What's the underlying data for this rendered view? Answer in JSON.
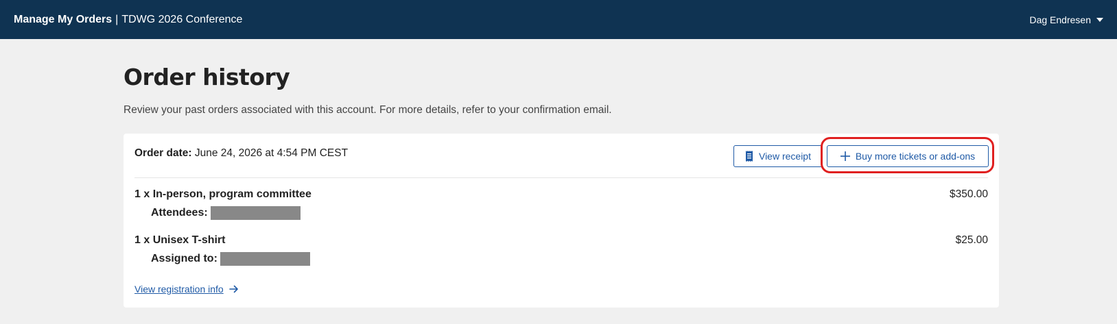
{
  "header": {
    "app_title": "Manage My Orders",
    "separator": "|",
    "event_name": "TDWG 2026 Conference",
    "user_name": "Dag Endresen"
  },
  "page": {
    "title": "Order history",
    "subtitle": "Review your past orders associated with this account. For more details, refer to your confirmation email."
  },
  "order": {
    "date_label": "Order date:",
    "date_value": "June 24, 2026 at 4:54 PM CEST",
    "view_receipt_label": "View receipt",
    "buy_more_label": "Buy more tickets or add-ons",
    "items": [
      {
        "name": "1 x In-person, program committee",
        "price": "$350.00",
        "sub_label": "Attendees:"
      },
      {
        "name": "1 x Unisex T-shirt",
        "price": "$25.00",
        "sub_label": "Assigned to:"
      }
    ],
    "registration_link": "View registration info"
  },
  "icons": {
    "receipt": "receipt-icon",
    "plus": "plus-icon",
    "arrow": "arrow-right-icon",
    "caret": "chevron-down-icon"
  },
  "colors": {
    "header_bg": "#0f3352",
    "accent": "#1f5aa6",
    "highlight": "#e02020",
    "page_bg": "#f0f0f0"
  }
}
